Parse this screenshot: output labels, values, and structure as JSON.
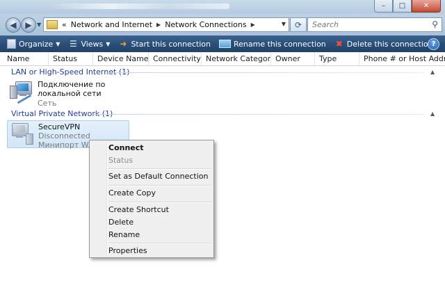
{
  "window": {
    "controls": {
      "minimize": "–",
      "maximize": "□",
      "close": "✕"
    }
  },
  "navigation": {
    "back_icon": "back-arrow-icon",
    "forward_icon": "forward-arrow-icon",
    "address": {
      "prefix": "«",
      "segments": [
        "Network and Internet",
        "Network Connections"
      ]
    },
    "refresh_icon": "refresh-icon",
    "search_placeholder": "Search"
  },
  "commandbar": {
    "organize": "Organize",
    "views": "Views",
    "start": "Start this connection",
    "rename": "Rename this connection",
    "delete": "Delete this connection",
    "help": "?"
  },
  "columns": [
    "Name",
    "Status",
    "Device Name",
    "Connectivity",
    "Network Category",
    "Owner",
    "Type",
    "Phone # or Host Addre..."
  ],
  "groups": [
    {
      "header": "LAN or High-Speed Internet (1)",
      "items": [
        {
          "name": "Подключение по локальной сети",
          "line1": "Сеть",
          "line2": ""
        }
      ]
    },
    {
      "header": "Virtual Private Network (1)",
      "items": [
        {
          "name": "SecureVPN",
          "line1": "Disconnected",
          "line2": "Минипорт WAN"
        }
      ]
    }
  ],
  "context_menu": {
    "connect": "Connect",
    "status": "Status",
    "set_default": "Set as Default Connection",
    "create_copy": "Create Copy",
    "create_shortcut": "Create Shortcut",
    "delete": "Delete",
    "rename": "Rename",
    "properties": "Properties"
  },
  "colors": {
    "command_bar": "#2a4e78",
    "group_header_text": "#1e3f9a",
    "selection": "#d2e6f8"
  }
}
